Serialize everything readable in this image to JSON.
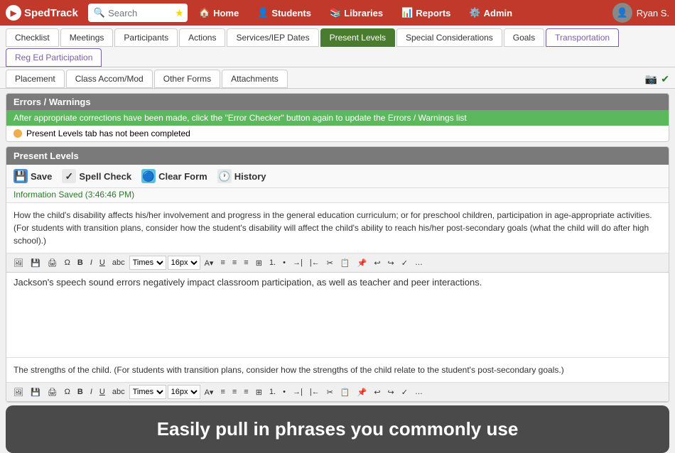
{
  "app": {
    "logo_text": "SpedTrack",
    "logo_icon": "S"
  },
  "nav": {
    "search_placeholder": "Search",
    "items": [
      {
        "id": "home",
        "label": "Home",
        "icon": "home"
      },
      {
        "id": "students",
        "label": "Students",
        "icon": "students"
      },
      {
        "id": "libraries",
        "label": "Libraries",
        "icon": "libraries"
      },
      {
        "id": "reports",
        "label": "Reports",
        "icon": "reports"
      },
      {
        "id": "admin",
        "label": "Admin",
        "icon": "admin"
      }
    ],
    "user_name": "Ryan S."
  },
  "tabs_row1": [
    {
      "id": "checklist",
      "label": "Checklist",
      "active": false
    },
    {
      "id": "meetings",
      "label": "Meetings",
      "active": false
    },
    {
      "id": "participants",
      "label": "Participants",
      "active": false
    },
    {
      "id": "actions",
      "label": "Actions",
      "active": false
    },
    {
      "id": "services-iep",
      "label": "Services/IEP Dates",
      "active": false
    },
    {
      "id": "present-levels",
      "label": "Present Levels",
      "active": true
    },
    {
      "id": "special-considerations",
      "label": "Special Considerations",
      "active": false
    },
    {
      "id": "goals",
      "label": "Goals",
      "active": false
    },
    {
      "id": "transportation",
      "label": "Transportation",
      "active": false,
      "style": "border"
    },
    {
      "id": "reg-ed",
      "label": "Reg Ed Participation",
      "active": false,
      "style": "border"
    }
  ],
  "tabs_row2": [
    {
      "id": "placement",
      "label": "Placement",
      "active": false
    },
    {
      "id": "class-accom",
      "label": "Class Accom/Mod",
      "active": false
    },
    {
      "id": "other-forms",
      "label": "Other Forms",
      "active": false
    },
    {
      "id": "attachments",
      "label": "Attachments",
      "active": false
    }
  ],
  "errors_section": {
    "header": "Errors / Warnings",
    "banner": "After appropriate corrections have been made, click the \"Error Checker\" button again to update the Errors / Warnings list",
    "warning_text": "Present Levels tab has not been completed"
  },
  "present_levels": {
    "header": "Present Levels",
    "toolbar": {
      "save": "Save",
      "spell_check": "Spell Check",
      "clear_form": "Clear Form",
      "history": "History"
    },
    "info_saved": "Information Saved (3:46:46 PM)",
    "description1": "How the child's disability affects his/her involvement and progress in the general education curriculum; or for preschool children, participation in age-appropriate activities. (For students with transition plans, consider how the student's disability will affect the child's ability to reach his/her post-secondary goals (what the child will do after high school).)",
    "editor1": {
      "font": "Times",
      "size": "16px",
      "content": "Jackson's speech sound errors negatively impact classroom participation, as well as teacher and peer interactions."
    },
    "description2": "The strengths of the child. (For students with transition plans, consider how the strengths of the child relate to the student's post-secondary goals.)",
    "editor2": {
      "font": "Times",
      "size": "16px"
    }
  },
  "tooltip": {
    "text": "Easily pull in phrases you commonly use"
  }
}
